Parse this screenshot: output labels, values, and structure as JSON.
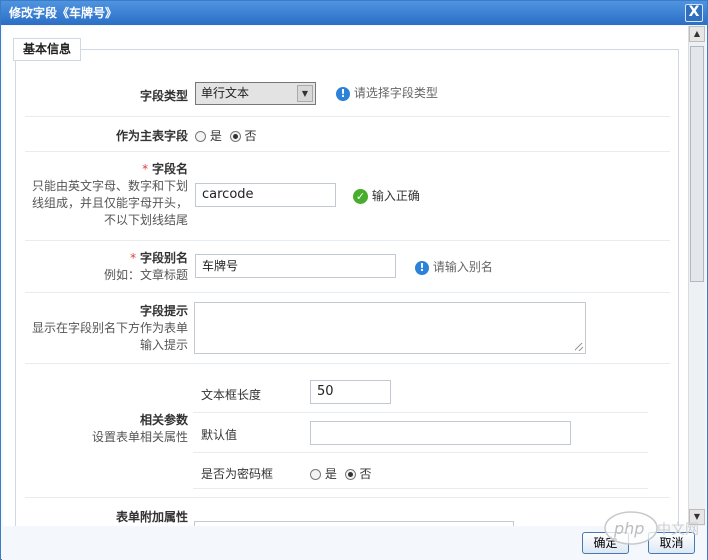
{
  "window": {
    "title": "修改字段《车牌号》",
    "close_label": "X"
  },
  "fieldset": {
    "legend": "基本信息"
  },
  "field_type": {
    "label": "字段类型",
    "selected": "单行文本",
    "hint": "请选择字段类型"
  },
  "primary_field": {
    "label": "作为主表字段",
    "options": [
      "是",
      "否"
    ],
    "selected": "否"
  },
  "field_name": {
    "required_mark": "*",
    "label": "字段名",
    "description": "只能由英文字母、数字和下划线组成，并且仅能字母开头，不以下划线结尾",
    "value": "carcode",
    "status": "输入正确"
  },
  "field_alias": {
    "required_mark": "*",
    "label": "字段别名",
    "description": "例如：文章标题",
    "value": "车牌号",
    "hint": "请输入别名"
  },
  "field_tip": {
    "label": "字段提示",
    "description": "显示在字段别名下方作为表单输入提示",
    "value": ""
  },
  "related_params": {
    "label": "相关参数",
    "description": "设置表单相关属性",
    "text_length": {
      "label": "文本框长度",
      "value": "50"
    },
    "default_value": {
      "label": "默认值",
      "value": ""
    },
    "is_password": {
      "label": "是否为密码框",
      "options": [
        "是",
        "否"
      ],
      "selected": "否"
    }
  },
  "form_attrs": {
    "label": "表单附加属性"
  },
  "buttons": {
    "ok": "确定",
    "cancel": "取消"
  },
  "watermark": "php 中文网",
  "colors": {
    "titlebar": "#2b6fc6",
    "required": "#e23b3b",
    "ok": "#46ad2d",
    "info": "#2c82d8"
  }
}
